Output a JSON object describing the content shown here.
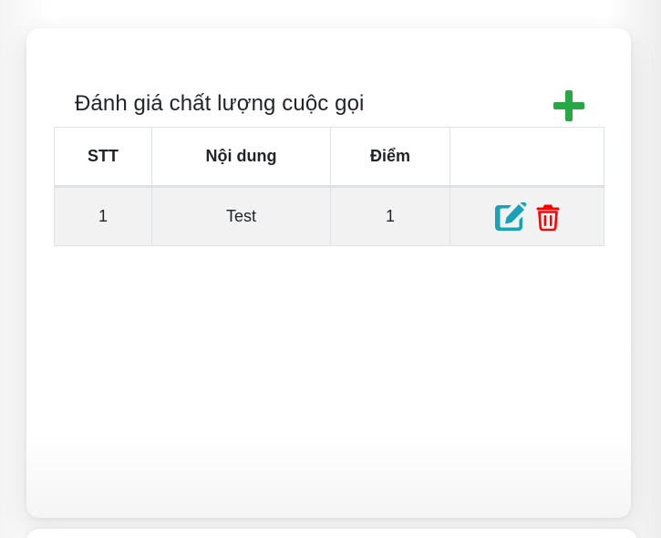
{
  "card": {
    "title": "Đánh giá chất lượng cuộc gọi"
  },
  "colors": {
    "add_icon": "#28a745",
    "edit_icon": "#17a2b8",
    "delete_icon": "#ff0000",
    "text": "#212529",
    "row_bg": "#f2f2f2",
    "border": "#dee2e6"
  },
  "icons": {
    "add": "plus-icon",
    "edit": "edit-icon",
    "delete": "trash-icon"
  },
  "table": {
    "headers": [
      "STT",
      "Nội dung",
      "Điểm",
      ""
    ],
    "rows": [
      {
        "stt": "1",
        "content": "Test",
        "score": "1"
      }
    ]
  }
}
